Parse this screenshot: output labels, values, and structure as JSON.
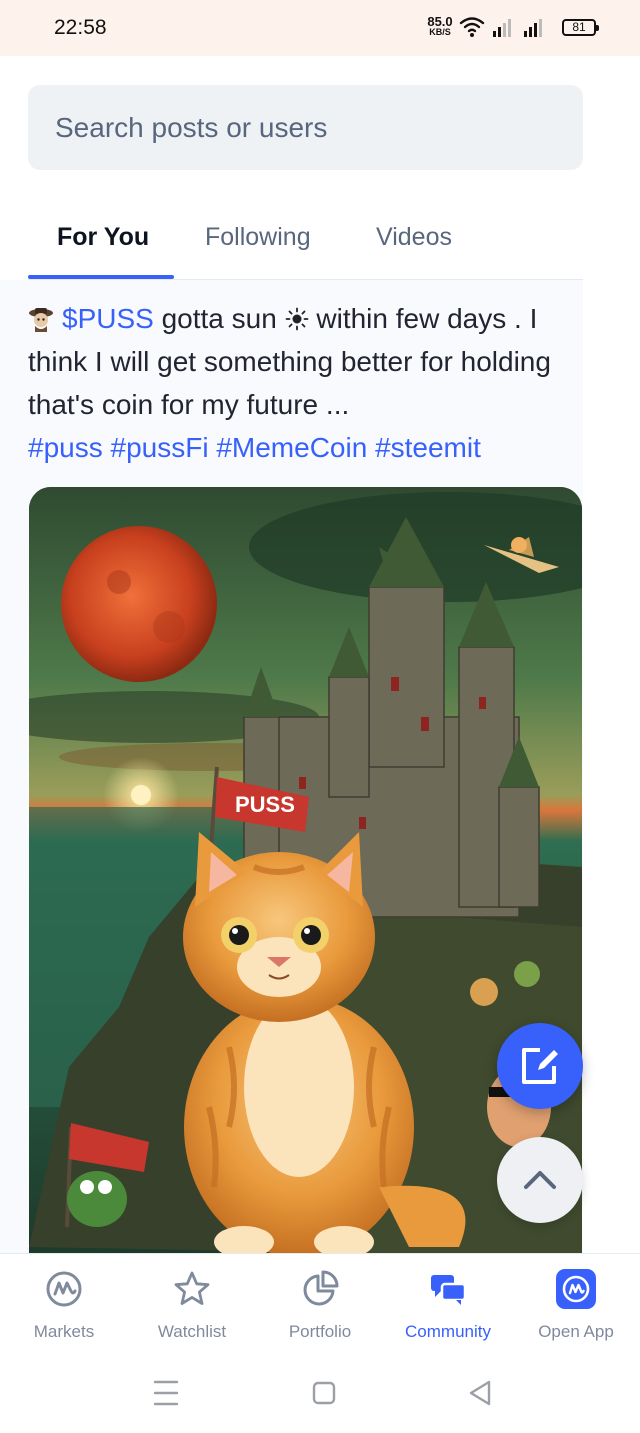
{
  "status_bar": {
    "time": "22:58",
    "net_speed": "85.0",
    "net_unit": "KB/S",
    "battery": "81"
  },
  "search": {
    "placeholder": "Search posts or users"
  },
  "tabs": [
    {
      "label": "For You",
      "active": true
    },
    {
      "label": "Following",
      "active": false
    },
    {
      "label": "Videos",
      "active": false
    }
  ],
  "post": {
    "ticker": "$PUSS",
    "text_1": " gotta sun ",
    "text_2": " within few days . I think I will get something better for holding that's coin for my future ...",
    "hashtags": [
      "#puss",
      "#pussFi",
      "#MemeCoin",
      "#steemit"
    ],
    "image_flag_text": "PUSS"
  },
  "bottom_nav": [
    {
      "label": "Markets",
      "icon": "markets-icon",
      "active": false
    },
    {
      "label": "Watchlist",
      "icon": "star-icon",
      "active": false
    },
    {
      "label": "Portfolio",
      "icon": "pie-chart-icon",
      "active": false
    },
    {
      "label": "Community",
      "icon": "chat-icon",
      "active": true
    },
    {
      "label": "Open App",
      "icon": "app-logo-icon",
      "active": false
    }
  ],
  "colors": {
    "accent": "#3861fb",
    "text_primary": "#0d1421",
    "text_secondary": "#58667e",
    "nav_inactive": "#808a9d"
  }
}
